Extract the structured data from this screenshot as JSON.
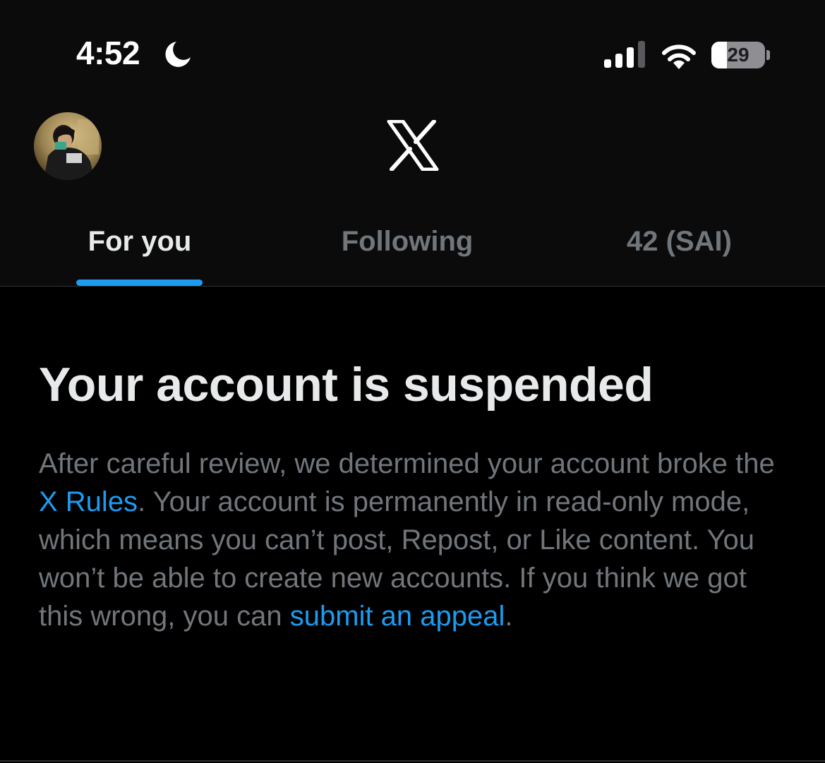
{
  "status_bar": {
    "time": "4:52",
    "battery_level": "29",
    "battery_fraction": 0.29,
    "icons": [
      "moon-icon",
      "cellular-signal-icon",
      "wifi-icon",
      "battery-icon"
    ]
  },
  "top_bar": {
    "avatar": "profile-avatar",
    "logo": "x-logo-icon"
  },
  "tabs": [
    {
      "label": "For you",
      "active": true
    },
    {
      "label": "Following",
      "active": false
    },
    {
      "label": "42 (SAI)",
      "active": false
    }
  ],
  "notice": {
    "title": "Your account is suspended",
    "body_part1": "After careful review, we determined your account broke the ",
    "x_rules_link": "X Rules",
    "body_part2": ". Your account is permanently in read-only mode, which means you can’t post, Repost, or Like content. You won’t be able to create new accounts. If you think we got this wrong, you can ",
    "appeal_link": "submit an appeal",
    "body_end": "."
  },
  "colors": {
    "background": "#000000",
    "header_background": "#0b0b0b",
    "primary_text": "#e7e9ea",
    "secondary_text": "#71767b",
    "accent": "#1d9bf0",
    "divider": "#2f3336"
  }
}
